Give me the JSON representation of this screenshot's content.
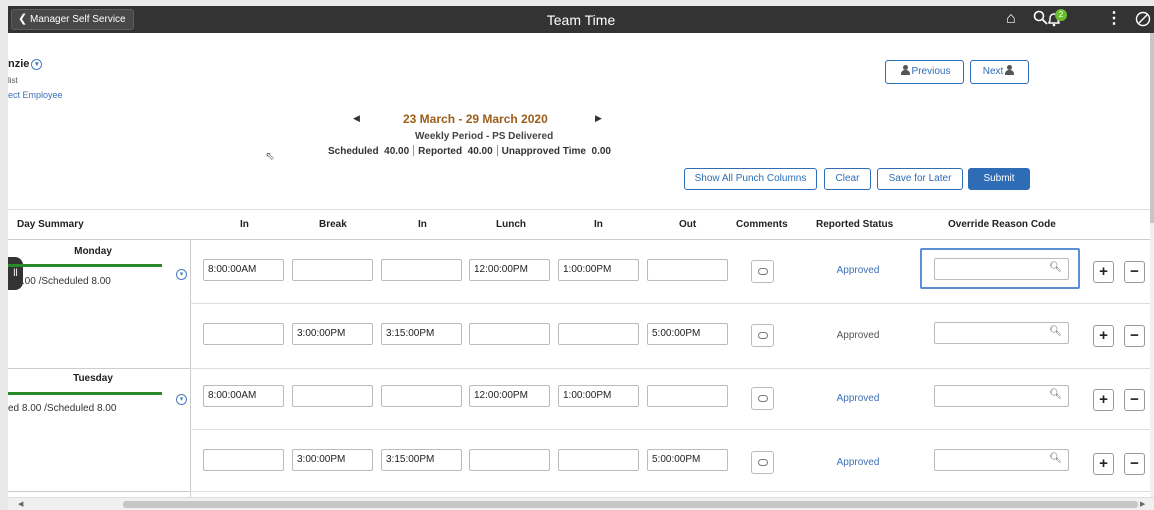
{
  "topbar": {
    "back_label": "Manager Self Service",
    "title": "Team Time",
    "icons": [
      "home-icon",
      "search-icon",
      "notification-icon",
      "actions-menu-icon",
      "navbar-icon"
    ],
    "notification_count": "2"
  },
  "employee": {
    "name": "nzie",
    "role": "list",
    "link": "ect Employee",
    "previous_label": "Previous",
    "next_label": "Next"
  },
  "period": {
    "range": "23 March - 29 March 2020",
    "type": "Weekly Period - PS Delivered",
    "scheduled_label": "Scheduled",
    "scheduled_value": "40.00",
    "reported_label": "Reported",
    "reported_value": "40.00",
    "unapproved_label": "Unapproved Time",
    "unapproved_value": "0.00"
  },
  "actions": {
    "show_all": "Show All Punch Columns",
    "clear": "Clear",
    "save_later": "Save for Later",
    "submit": "Submit"
  },
  "table": {
    "headers": [
      "Day Summary",
      "In",
      "Break",
      "In",
      "Lunch",
      "In",
      "Out",
      "Comments",
      "Reported Status",
      "Override Reason Code"
    ],
    "days": [
      {
        "name": "Monday",
        "summary": "d 8.00 /Scheduled 8.00"
      },
      {
        "name": "Tuesday",
        "summary": "ed 8.00 /Scheduled 8.00"
      }
    ],
    "rows": [
      {
        "punches": [
          "8:00:00AM",
          "",
          "",
          "12:00:00PM",
          "1:00:00PM",
          ""
        ],
        "status": "Approved"
      },
      {
        "punches": [
          "",
          "3:00:00PM",
          "3:15:00PM",
          "",
          "",
          "5:00:00PM"
        ],
        "status": "Approved"
      },
      {
        "punches": [
          "8:00:00AM",
          "",
          "",
          "12:00:00PM",
          "1:00:00PM",
          ""
        ],
        "status": "Approved"
      },
      {
        "punches": [
          "",
          "3:00:00PM",
          "3:15:00PM",
          "",
          "",
          "5:00:00PM"
        ],
        "status": "Approved"
      }
    ]
  },
  "colors": {
    "topbar": "#333333",
    "accent": "#2e6db5",
    "period_title": "#9c5d1a",
    "day_bar": "#2a8a2a",
    "status_link": "#3a6fb5"
  }
}
